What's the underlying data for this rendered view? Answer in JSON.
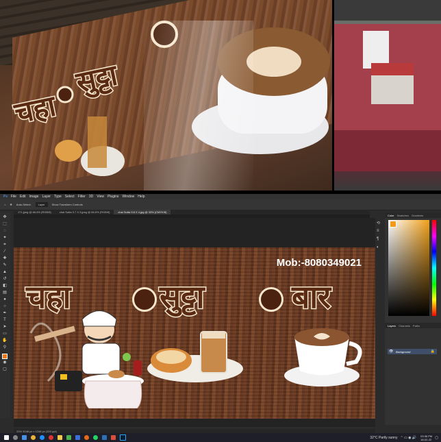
{
  "app": {
    "menu": [
      "File",
      "Edit",
      "Image",
      "Layer",
      "Type",
      "Select",
      "Filter",
      "3D",
      "View",
      "Plugins",
      "Window",
      "Help"
    ],
    "options": [
      "Auto-Select:",
      "Layer",
      "Show Transform Controls"
    ],
    "tabs": [
      {
        "label": "171.jpeg @ 66.6% (RGB/8)"
      },
      {
        "label": "chai Sutta 3.7 X 3.jpeg @ 66.6% (RGB/8)"
      },
      {
        "label": "chai Sutta 9.8 X 4.jpg @ 33% (CMYK/8)",
        "active": true
      }
    ],
    "panels": {
      "color_tabs": [
        "Color",
        "Swatches",
        "Gradients"
      ],
      "layer_tabs": [
        "Layers",
        "Channels",
        "Paths"
      ]
    },
    "layer_name": "Background",
    "status": "33%    3048 px x 1248 px (300 ppi)"
  },
  "artwork": {
    "mob": "Mob:-8080349021",
    "brand_words": [
      "चहा",
      "सुट्टा",
      "बार"
    ]
  },
  "taskbar": {
    "weather": "32°C  Partly sunny",
    "time": "03:36 PM",
    "date": "18-02-22"
  },
  "colors": {
    "accent": "#f5e6cc",
    "brand_text": "#5a2a12",
    "wood": "#6b3a22"
  },
  "icons": [
    "windows-start-icon",
    "search-icon",
    "move-tool-icon",
    "color-picker-icon"
  ]
}
